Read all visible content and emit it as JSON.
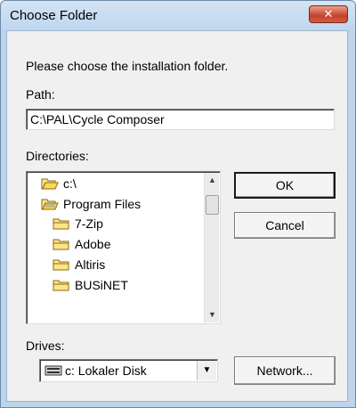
{
  "window": {
    "title": "Choose Folder",
    "close_glyph": "✕"
  },
  "dialog": {
    "prompt": "Please choose the installation folder.",
    "path_label": "Path:",
    "path_value": "C:\\PAL\\Cycle Composer",
    "directories_label": "Directories:",
    "directories": [
      {
        "label": "c:\\",
        "icon": "open-folder-icon"
      },
      {
        "label": "Program Files",
        "icon": "open-folder-icon"
      },
      {
        "label": "7-Zip",
        "icon": "folder-icon"
      },
      {
        "label": "Adobe",
        "icon": "folder-icon"
      },
      {
        "label": "Altiris",
        "icon": "folder-icon"
      },
      {
        "label": "BUSiNET",
        "icon": "folder-icon"
      }
    ],
    "drives_label": "Drives:",
    "drive_value": "c: Lokaler Disk",
    "drive_icon": "hard-disk-icon",
    "ok_label": "OK",
    "cancel_label": "Cancel",
    "network_label": "Network..."
  },
  "colors": {
    "folder_fill": "#ffe58a",
    "folder_stroke": "#8a6a10"
  }
}
